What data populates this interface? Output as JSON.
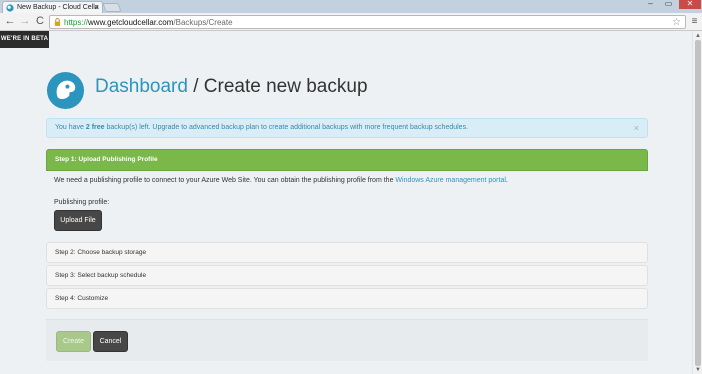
{
  "browser": {
    "tab_title": "New Backup - Cloud Cella",
    "tab_close": "×",
    "url_scheme": "https://",
    "url_host": "www.getcloudcellar.com",
    "url_path": "/Backups/Create",
    "window_controls": {
      "minimize": "–",
      "maximize": "▭",
      "close": "✕"
    },
    "nav": {
      "back": "←",
      "forward": "→",
      "reload": "C"
    },
    "star": "☆",
    "menu": "≡"
  },
  "banner": {
    "beta": "WE'RE IN BETA"
  },
  "header": {
    "crumb": "Dashboard",
    "separator": " / ",
    "title": "Create new backup"
  },
  "alert": {
    "prefix": "You have ",
    "count": "2 free",
    "suffix": " backup(s) left. Upgrade to advanced backup plan to create additional backups with more frequent backup schedules.",
    "close": "×"
  },
  "steps": [
    {
      "label": "Step 1: Upload Publishing Profile"
    },
    {
      "label": "Step 2: Choose backup storage"
    },
    {
      "label": "Step 3: Select backup schedule"
    },
    {
      "label": "Step 4: Customize"
    }
  ],
  "step1": {
    "description": "We need a publishing profile to connect to your Azure Web Site. You can obtain the publishing profile from the ",
    "link": "Windows Azure management portal",
    "description_end": ".",
    "field_label": "Publishing profile:",
    "upload_button": "Upload File"
  },
  "actions": {
    "create": "Create",
    "cancel": "Cancel"
  },
  "colors": {
    "accent": "#2b95bd",
    "step_active": "#7ab84a",
    "alert_bg": "#d9edf7",
    "button_dark": "#474747"
  }
}
